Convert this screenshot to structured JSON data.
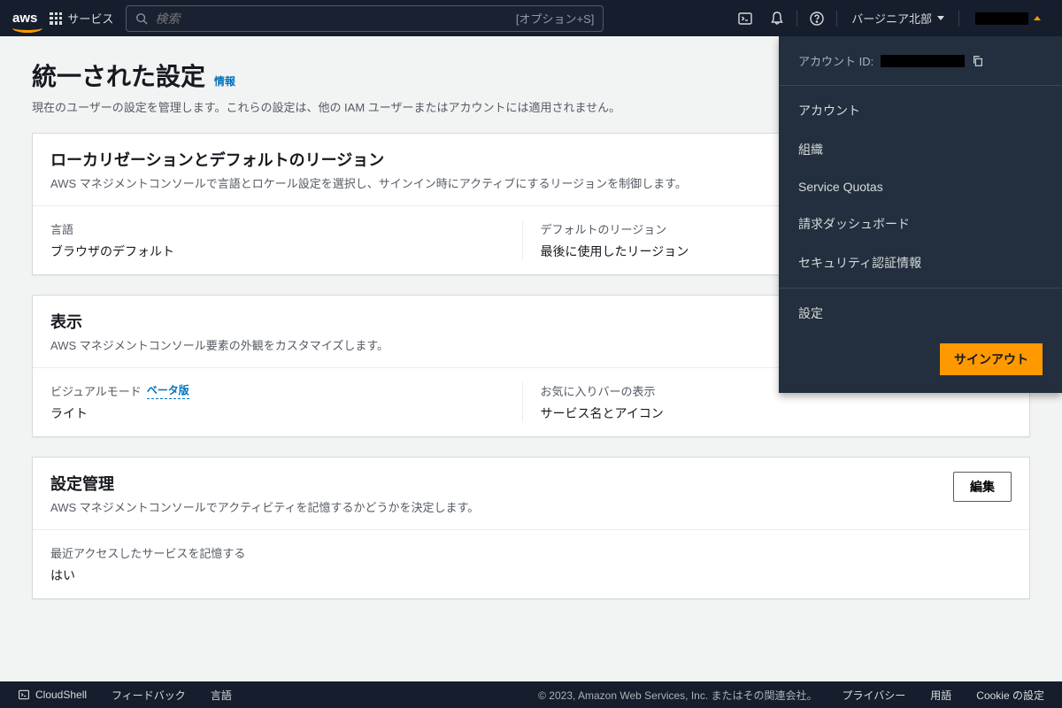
{
  "navbar": {
    "logo_text": "aws",
    "services_label": "サービス",
    "search_placeholder": "検索",
    "search_hint": "[オプション+S]",
    "region_label": "バージニア北部"
  },
  "dropdown": {
    "account_id_label": "アカウント ID:",
    "items": [
      "アカウント",
      "組織",
      "Service Quotas",
      "請求ダッシュボード",
      "セキュリティ認証情報"
    ],
    "settings_label": "設定",
    "signout_label": "サインアウト"
  },
  "page": {
    "title": "統一された設定",
    "info_label": "情報",
    "description": "現在のユーザーの設定を管理します。これらの設定は、他の IAM ユーザーまたはアカウントには適用されません。"
  },
  "localization_card": {
    "title": "ローカリゼーションとデフォルトのリージョン",
    "subtitle": "AWS マネジメントコンソールで言語とロケール設定を選択し、サインイン時にアクティブにするリージョンを制御します。",
    "language_label": "言語",
    "language_value": "ブラウザのデフォルト",
    "region_label": "デフォルトのリージョン",
    "region_value": "最後に使用したリージョン"
  },
  "display_card": {
    "title": "表示",
    "subtitle": "AWS マネジメントコンソール要素の外観をカスタマイズします。",
    "visual_mode_label": "ビジュアルモード",
    "beta_label": "ベータ版",
    "visual_mode_value": "ライト",
    "favorites_label": "お気に入りバーの表示",
    "favorites_value": "サービス名とアイコン"
  },
  "settings_card": {
    "title": "設定管理",
    "subtitle": "AWS マネジメントコンソールでアクティビティを記憶するかどうかを決定します。",
    "edit_label": "編集",
    "remember_label": "最近アクセスしたサービスを記憶する",
    "remember_value": "はい"
  },
  "footer": {
    "cloudshell": "CloudShell",
    "feedback": "フィードバック",
    "language": "言語",
    "copyright": "© 2023, Amazon Web Services, Inc. またはその関連会社。",
    "privacy": "プライバシー",
    "terms": "用語",
    "cookies": "Cookie の設定"
  }
}
